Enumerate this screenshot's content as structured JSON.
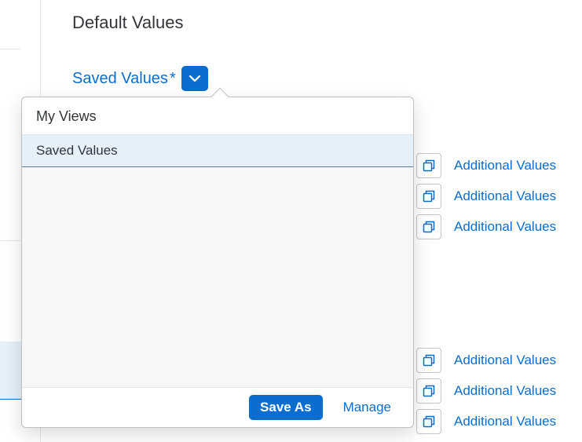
{
  "header": {
    "title": "Default Values",
    "saved_values_label": "Saved Values",
    "modified_indicator": "*"
  },
  "popover": {
    "title": "My Views",
    "items": [
      "Saved Values"
    ],
    "footer": {
      "save_as_label": "Save As",
      "manage_label": "Manage"
    }
  },
  "rows": [
    {
      "link_label": "Additional Values"
    },
    {
      "link_label": "Additional Values"
    },
    {
      "link_label": "Additional Values"
    },
    {
      "link_label": "Additional Values"
    },
    {
      "link_label": "Additional Values"
    },
    {
      "link_label": "Additional Values"
    }
  ],
  "icons": {
    "chevron_down": "chevron-down-icon",
    "value_help": "value-help-icon"
  }
}
